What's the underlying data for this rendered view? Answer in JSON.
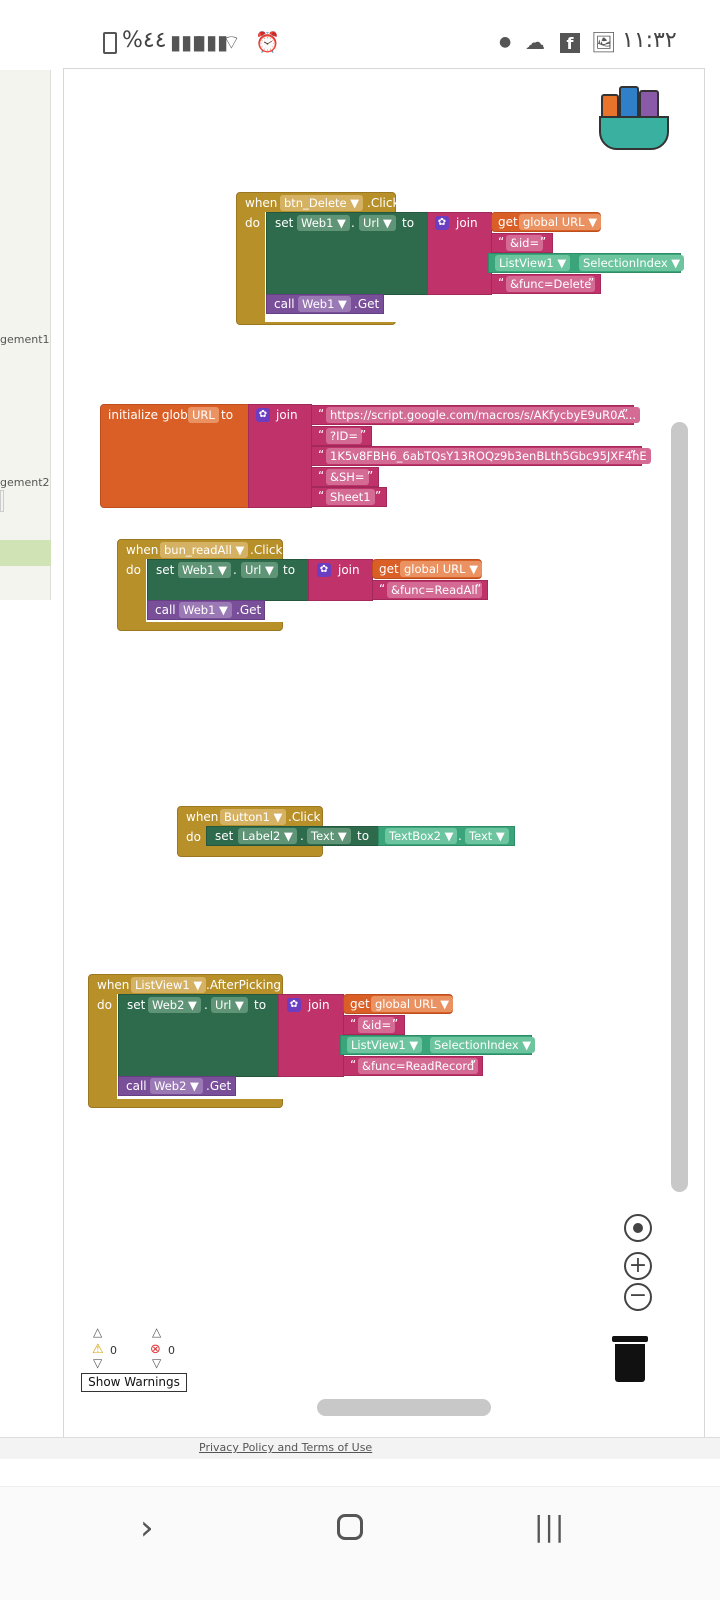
{
  "status_bar": {
    "time": "١١:٣٢",
    "battery": "%٤٤",
    "icons": [
      "battery-icon",
      "signal-icon",
      "signal-icon",
      "wifi-icon",
      "alarm-icon",
      "dot-icon",
      "cloud-icon",
      "facebook-icon",
      "image-icon"
    ]
  },
  "sidebar": {
    "items": [
      "gement1",
      "gement2"
    ]
  },
  "blocks": {
    "delete": {
      "when": "when",
      "component": "btn_Delete",
      "event": ".Click",
      "do": "do",
      "set": "set",
      "target": "Web1",
      "dot": ".",
      "prop": "Url",
      "to": "to",
      "join": "join",
      "get": "get",
      "var": "global URL",
      "s1": "&id=",
      "list": "ListView1",
      "sel": "SelectionIndex",
      "s2": "&func=Delete",
      "call": "call",
      "call_comp": "Web1",
      "method": ".Get"
    },
    "init": {
      "label": "initialize global",
      "name": "URL",
      "to": "to",
      "join": "join",
      "s1": "https://script.google.com/macros/s/AKfycbyE9uR0A...",
      "s2": "?ID=",
      "s3": "1K5v8FBH6_6abTQsY13ROQz9b3enBLth5Gbc95JXF4hE",
      "s4": "&SH=",
      "s5": "Sheet1"
    },
    "readall": {
      "when": "when",
      "component": "bun_readAll",
      "event": ".Click",
      "do": "do",
      "set": "set",
      "target": "Web1",
      "dot": ".",
      "prop": "Url",
      "to": "to",
      "join": "join",
      "get": "get",
      "var": "global URL",
      "s1": "&func=ReadAll",
      "call": "call",
      "call_comp": "Web1",
      "method": ".Get"
    },
    "button1": {
      "when": "when",
      "component": "Button1",
      "event": ".Click",
      "do": "do",
      "set": "set",
      "target": "Label2",
      "dot": ".",
      "prop": "Text",
      "to": "to",
      "src": "TextBox2",
      "src_dot": ".",
      "src_prop": "Text"
    },
    "picking": {
      "when": "when",
      "component": "ListView1",
      "event": ".AfterPicking",
      "do": "do",
      "set": "set",
      "target": "Web2",
      "dot": ".",
      "prop": "Url",
      "to": "to",
      "join": "join",
      "get": "get",
      "var": "global URL",
      "s1": "&id=",
      "list": "ListView1",
      "sel": "SelectionIndex",
      "s2": "&func=ReadRecord",
      "call": "call",
      "call_comp": "Web2",
      "method": ".Get"
    }
  },
  "warnings": {
    "warning_count": "0",
    "error_count": "0",
    "button": "Show Warnings"
  },
  "footer": {
    "link": "Privacy Policy and Terms of Use"
  },
  "colors": {
    "event": "#b8902a",
    "set": "#2e6b4c",
    "join": "#c0336a",
    "variable": "#d95f27",
    "call": "#7a4f9a",
    "component": "#3aa57a"
  }
}
